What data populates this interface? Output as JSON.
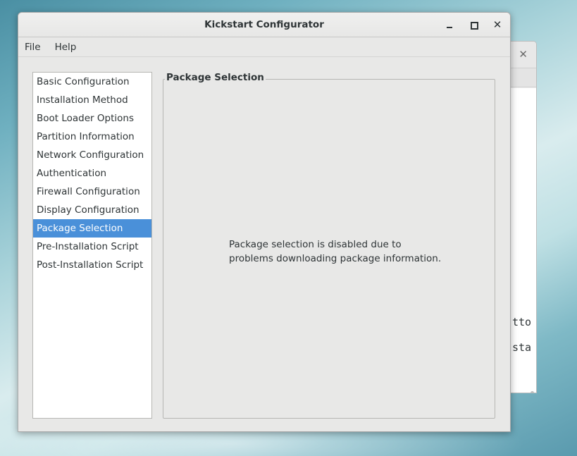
{
  "window": {
    "title": "Kickstart Configurator"
  },
  "menu": {
    "items": [
      {
        "label": "File"
      },
      {
        "label": "Help"
      }
    ]
  },
  "sidebar": {
    "selected": "Package Selection",
    "items": [
      {
        "label": "Basic Configuration"
      },
      {
        "label": "Installation Method"
      },
      {
        "label": "Boot Loader Options"
      },
      {
        "label": "Partition Information"
      },
      {
        "label": "Network Configuration"
      },
      {
        "label": "Authentication"
      },
      {
        "label": "Firewall Configuration"
      },
      {
        "label": "Display Configuration"
      },
      {
        "label": "Package Selection"
      },
      {
        "label": "Pre-Installation Script"
      },
      {
        "label": "Post-Installation Script"
      }
    ]
  },
  "panel": {
    "title": "Package Selection",
    "message_line1": "Package selection is disabled due to",
    "message_line2": "problems downloading package information."
  },
  "background_window": {
    "text_line1": "tto",
    "text_line2": "sta"
  },
  "colors": {
    "selection": "#4a90d9",
    "window_bg": "#e8e8e7"
  }
}
